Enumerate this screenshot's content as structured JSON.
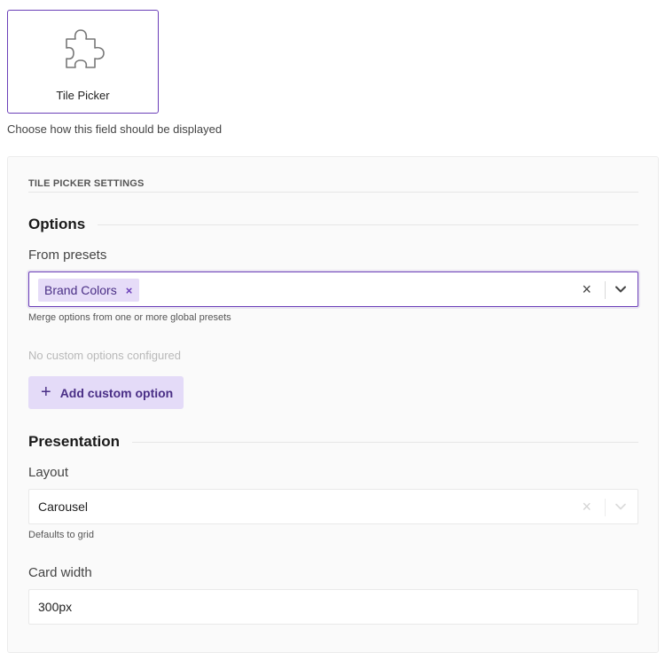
{
  "tile": {
    "label": "Tile Picker",
    "icon": "puzzle-icon"
  },
  "display_help": "Choose how this field should be displayed",
  "settings": {
    "title": "TILE PICKER SETTINGS",
    "options": {
      "heading": "Options",
      "presets_label": "From presets",
      "selected_presets": [
        {
          "label": "Brand Colors",
          "remove": "×"
        }
      ],
      "clear_icon": "×",
      "presets_hint": "Merge options from one or more global presets",
      "empty_text": "No custom options configured",
      "add_button": {
        "icon": "+",
        "label": "Add custom option"
      }
    },
    "presentation": {
      "heading": "Presentation",
      "layout_label": "Layout",
      "layout_value": "Carousel",
      "layout_clear_icon": "×",
      "layout_hint": "Defaults to grid",
      "card_width_label": "Card width",
      "card_width_value": "300px"
    }
  },
  "colors": {
    "accent": "#6b3fb8",
    "chip_bg": "#e6dcf8",
    "button_bg": "#e4dbf8"
  }
}
